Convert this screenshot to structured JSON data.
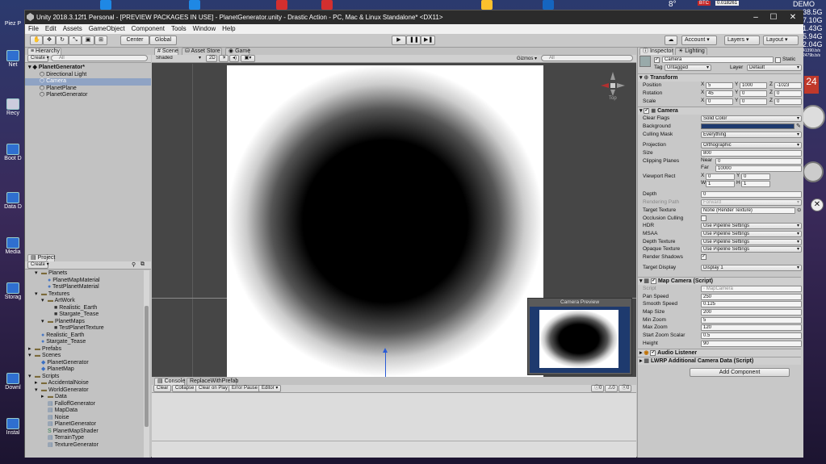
{
  "desktop": {
    "left_icons": [
      "Piez P",
      "Net",
      "Recy",
      "Boot D",
      "Data D",
      "Media",
      "Storag",
      "Downl",
      "Instal"
    ],
    "right_stats": [
      "38.5G",
      "7.10G",
      "1.43G",
      "5.94G",
      "2.04G"
    ],
    "right_small": [
      "41390.b/s",
      "2479b.b/s"
    ],
    "top_right_text": [
      "DEMO",
      "3",
      "8°",
      "BTC",
      "0.018261"
    ]
  },
  "window": {
    "title": "Unity 2018.3.12f1 Personal - [PREVIEW PACKAGES IN USE] - PlanetGenerator.unity - Drastic Action - PC, Mac & Linux Standalone* <DX11>",
    "controls": [
      "–",
      "☐",
      "✕"
    ]
  },
  "menu": [
    "File",
    "Edit",
    "Assets",
    "GameObject",
    "Component",
    "Tools",
    "Window",
    "Help"
  ],
  "toolbar": {
    "pivot": "Center",
    "space": "Global",
    "account": "Account",
    "layers": "Layers",
    "layout": "Layout"
  },
  "hierarchy": {
    "tab": "Hierarchy",
    "create": "Create",
    "search_placeholder": "All",
    "scene": "PlanetGenerator*",
    "items": [
      "Directional Light",
      "Camera",
      "PlanetPlane",
      "PlanetGenerator"
    ]
  },
  "scene": {
    "tabs": [
      "Scene",
      "Asset Store",
      "Game"
    ],
    "shading": "Shaded",
    "mode2d": "2D",
    "gizmos": "Gizmos",
    "search_placeholder": "All",
    "gizmo_label": "Top",
    "camera_preview": "Camera Preview"
  },
  "project": {
    "tab": "Project",
    "create": "Create",
    "items": [
      {
        "label": "Planets",
        "depth": 1,
        "type": "folder",
        "open": true
      },
      {
        "label": "PlanetMapMaterial",
        "depth": 2,
        "type": "material"
      },
      {
        "label": "TestPlanetMaterial",
        "depth": 2,
        "type": "material"
      },
      {
        "label": "Textures",
        "depth": 1,
        "type": "folder",
        "open": true
      },
      {
        "label": "ArtWork",
        "depth": 2,
        "type": "folder",
        "open": true
      },
      {
        "label": "Realistic_Earth",
        "depth": 3,
        "type": "texture"
      },
      {
        "label": "Stargate_Tease",
        "depth": 3,
        "type": "texture"
      },
      {
        "label": "PlanetMaps",
        "depth": 2,
        "type": "folder",
        "open": true
      },
      {
        "label": "TestPlanetTexture",
        "depth": 3,
        "type": "texture"
      },
      {
        "label": "Realistic_Earth",
        "depth": 1,
        "type": "material"
      },
      {
        "label": "Stargate_Tease",
        "depth": 1,
        "type": "material"
      },
      {
        "label": "Prefabs",
        "depth": 0,
        "type": "folder"
      },
      {
        "label": "Scenes",
        "depth": 0,
        "type": "folder",
        "open": true
      },
      {
        "label": "PlanetGenerator",
        "depth": 1,
        "type": "scene"
      },
      {
        "label": "PlanetMap",
        "depth": 1,
        "type": "scene"
      },
      {
        "label": "Scripts",
        "depth": 0,
        "type": "folder",
        "open": true
      },
      {
        "label": "AccidentalNoise",
        "depth": 1,
        "type": "folder"
      },
      {
        "label": "WorldGenerator",
        "depth": 1,
        "type": "folder",
        "open": true
      },
      {
        "label": "Data",
        "depth": 2,
        "type": "folder"
      },
      {
        "label": "FalloffGenerator",
        "depth": 2,
        "type": "script"
      },
      {
        "label": "MapData",
        "depth": 2,
        "type": "script"
      },
      {
        "label": "Noise",
        "depth": 2,
        "type": "script"
      },
      {
        "label": "PlanetGenerator",
        "depth": 2,
        "type": "script"
      },
      {
        "label": "PlanetMapShader",
        "depth": 2,
        "type": "shader"
      },
      {
        "label": "TerrainType",
        "depth": 2,
        "type": "script"
      },
      {
        "label": "TextureGenerator",
        "depth": 2,
        "type": "script"
      }
    ]
  },
  "console": {
    "tabs": [
      "Console",
      "ReplaceWithPrefab"
    ],
    "buttons": [
      "Clear",
      "Collapse",
      "Clear on Play",
      "Error Pause",
      "Editor"
    ],
    "counts": [
      "0",
      "0",
      "0"
    ]
  },
  "inspector": {
    "tabs": [
      "Inspector",
      "Lighting"
    ],
    "object_name": "Camera",
    "static_label": "Static",
    "tag_label": "Tag",
    "tag": "Untagged",
    "layer_label": "Layer",
    "layer": "Default",
    "transform": {
      "title": "Transform",
      "position_label": "Position",
      "position": [
        "5",
        "1000",
        "-1023"
      ],
      "rotation_label": "Rotation",
      "rotation": [
        "45",
        "0",
        "0"
      ],
      "scale_label": "Scale",
      "scale": [
        "0",
        "0",
        "0"
      ]
    },
    "camera": {
      "title": "Camera",
      "clear_flags_label": "Clear Flags",
      "clear_flags": "Solid Color",
      "background_label": "Background",
      "background_color": "#1e3a6e",
      "culling_label": "Culling Mask",
      "culling": "Everything",
      "projection_label": "Projection",
      "projection": "Orthographic",
      "size_label": "Size",
      "size": "800",
      "clipping_label": "Clipping Planes",
      "near_label": "Near",
      "near": "0",
      "far_label": "Far",
      "far": "10000",
      "viewport_label": "Viewport Rect",
      "vx": "0",
      "vy": "0",
      "vw": "1",
      "vh": "1",
      "depth_label": "Depth",
      "depth": "0",
      "rendering_path_label": "Rendering Path",
      "rendering_path": "Forward",
      "target_texture_label": "Target Texture",
      "target_texture": "None (Render Texture)",
      "occlusion_label": "Occlusion Culling",
      "hdr_label": "HDR",
      "hdr": "Use Pipeline Settings",
      "msaa_label": "MSAA",
      "msaa": "Use Pipeline Settings",
      "depth_tex_label": "Depth Texture",
      "depth_tex": "Use Pipeline Settings",
      "opaque_tex_label": "Opaque Texture",
      "opaque_tex": "Use Pipeline Settings",
      "render_shadows_label": "Render Shadows",
      "target_display_label": "Target Display",
      "target_display": "Display 1"
    },
    "map_camera": {
      "title": "Map Camera (Script)",
      "script_label": "Script",
      "script": "MapCamera",
      "pan_speed_label": "Pan Speed",
      "pan_speed": "250",
      "smooth_speed_label": "Smooth Speed",
      "smooth_speed": "0.125",
      "map_size_label": "Map Size",
      "map_size": "200",
      "min_zoom_label": "Min Zoom",
      "min_zoom": "5",
      "max_zoom_label": "Max Zoom",
      "max_zoom": "120",
      "zoom_scalar_label": "Start Zoom Scalar",
      "zoom_scalar": "0.5",
      "height_label": "Height",
      "height": "90"
    },
    "audio_listener": "Audio Listener",
    "lwrp": "LWRP Additional Camera Data (Script)",
    "add_component": "Add Component"
  }
}
